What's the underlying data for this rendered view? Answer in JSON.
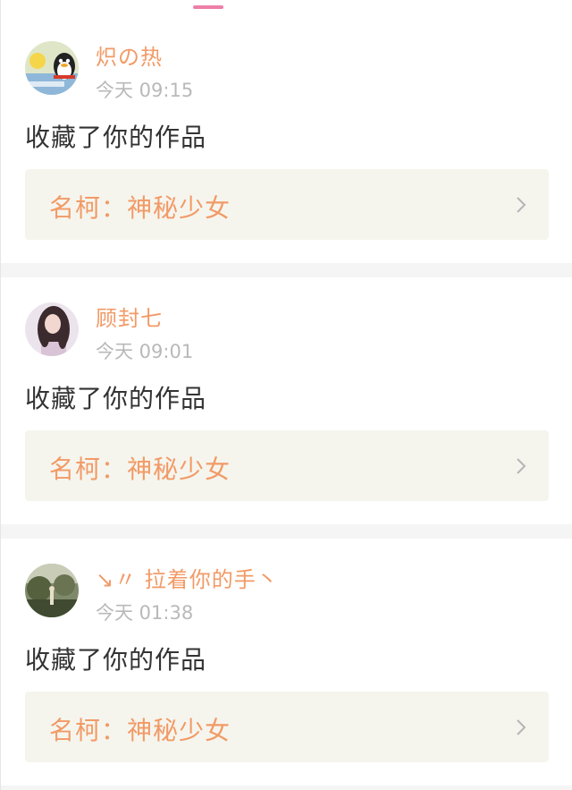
{
  "colors": {
    "accent_pink": "#ee7fa8",
    "username_orange": "#f29a66",
    "timestamp_gray": "#b9b9b9",
    "work_box_bg": "#f5f5ee",
    "separator_bg": "#f6f5f6"
  },
  "notifications": [
    {
      "username": "炽の热",
      "time": "今天 09:15",
      "action": "收藏了你的作品",
      "work_title": "名柯：神秘少女",
      "avatar_icon": "qq-penguin-avatar-icon",
      "chevron_icon": "chevron-right-icon"
    },
    {
      "username": "顾封七",
      "time": "今天 09:01",
      "action": "收藏了你的作品",
      "work_title": "名柯：神秘少女",
      "avatar_icon": "girl-portrait-avatar-icon",
      "chevron_icon": "chevron-right-icon"
    },
    {
      "username": "↘〃 拉着你的手丶",
      "time": "今天 01:38",
      "action": "收藏了你的作品",
      "work_title": "名柯：神秘少女",
      "avatar_icon": "outdoor-scene-avatar-icon",
      "chevron_icon": "chevron-right-icon"
    }
  ]
}
